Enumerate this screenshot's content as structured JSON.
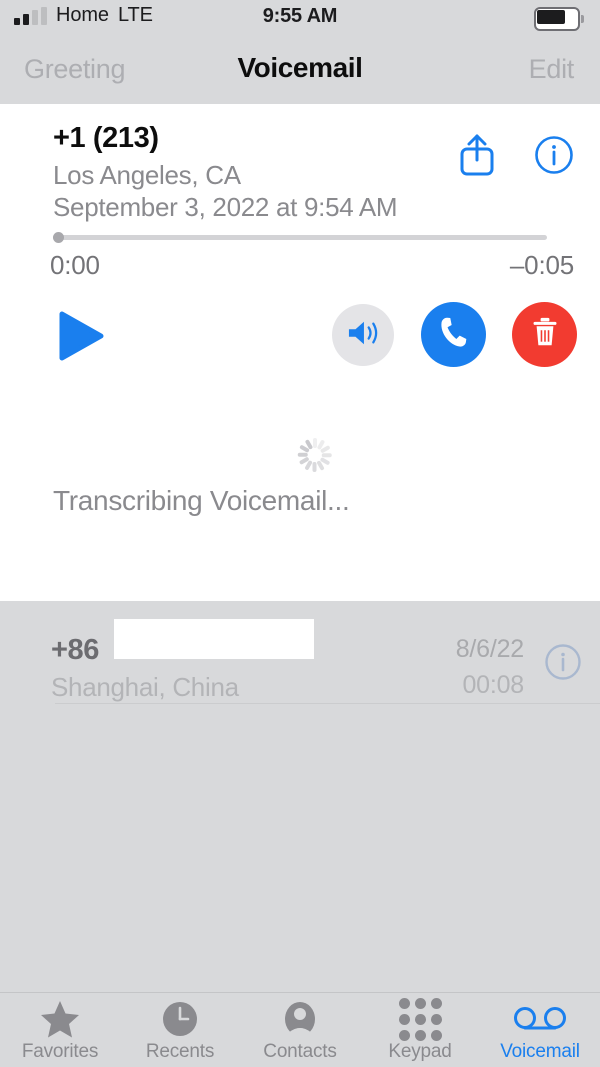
{
  "status_bar": {
    "carrier": "Home",
    "network": "LTE",
    "time": "9:55 AM",
    "signal_bars_filled": 2,
    "signal_bars_total": 4,
    "battery_level_percent": 70
  },
  "nav_bar": {
    "left_label": "Greeting",
    "title": "Voicemail",
    "right_label": "Edit"
  },
  "detail": {
    "number": "+1 (213)",
    "location": "Los Angeles, CA",
    "datetime": "September 3, 2022 at 9:54 AM",
    "elapsed": "0:00",
    "remaining": "–0:05",
    "progress_percent": 0,
    "share_icon": "share-icon",
    "info_icon": "info-icon",
    "controls": {
      "play": "play-icon",
      "speaker": "speaker-icon",
      "call": "phone-icon",
      "delete": "trash-icon"
    },
    "transcription_status": "Transcribing Voicemail...",
    "spinner_icon": "loading-spinner-icon"
  },
  "list": {
    "rows": [
      {
        "number": "+86",
        "redacted": true,
        "location": "Shanghai, China",
        "date": "8/6/22",
        "duration": "00:08",
        "info_icon": "info-icon"
      }
    ]
  },
  "tab_bar": {
    "items": [
      {
        "label": "Favorites",
        "icon": "star-icon",
        "active": false
      },
      {
        "label": "Recents",
        "icon": "clock-icon",
        "active": false
      },
      {
        "label": "Contacts",
        "icon": "person-icon",
        "active": false
      },
      {
        "label": "Keypad",
        "icon": "keypad-icon",
        "active": false
      },
      {
        "label": "Voicemail",
        "icon": "voicemail-icon",
        "active": true
      }
    ]
  },
  "colors": {
    "accent_blue": "#1a7fee",
    "danger_red": "#f23b30",
    "chrome_gray": "#d8d9db",
    "card_white": "#ffffff",
    "muted_text": "#8a8a8e"
  }
}
